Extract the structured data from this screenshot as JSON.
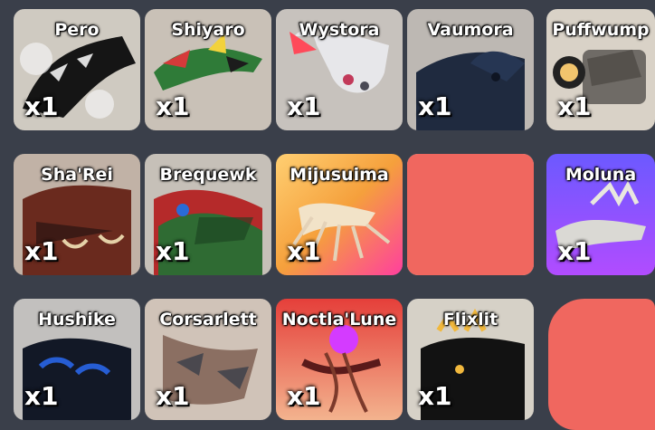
{
  "items": [
    {
      "name": "Pero",
      "count": "x1"
    },
    {
      "name": "Shiyaro",
      "count": "x1"
    },
    {
      "name": "Wystora",
      "count": "x1"
    },
    {
      "name": "Vaumora",
      "count": "x1"
    },
    {
      "name": "Puffwump",
      "count": "x1"
    },
    {
      "name": "Sha'Rei",
      "count": "x1"
    },
    {
      "name": "Brequewk",
      "count": "x1"
    },
    {
      "name": "Mijusuima",
      "count": "x1"
    },
    {
      "name": "",
      "count": ""
    },
    {
      "name": "Moluna",
      "count": "x1"
    },
    {
      "name": "Hushike",
      "count": "x1"
    },
    {
      "name": "Corsarlett",
      "count": "x1"
    },
    {
      "name": "Noctla'Lune",
      "count": "x1"
    },
    {
      "name": "Flixlit",
      "count": "x1"
    }
  ],
  "colors": {
    "background": "#3a3f4a",
    "card": "#c9c3b8",
    "redaction": "#f0675f",
    "mijusuima_bg": "#f0a22a",
    "moluna_bg": "#8a58ff",
    "noctlalune_bg": "#e2463b"
  },
  "icons": [
    "creature-portrait"
  ]
}
